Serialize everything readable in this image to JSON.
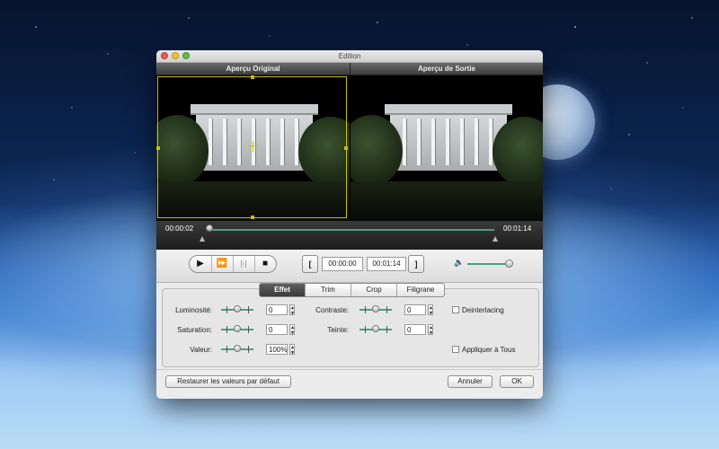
{
  "window": {
    "title": "Edition"
  },
  "preview": {
    "original_label": "Aperçu Original",
    "output_label": "Aperçu de Sortie"
  },
  "timeline": {
    "current_time": "00:00:02",
    "end_time": "00:01:14",
    "position_fraction": 0.03
  },
  "playback": {
    "play_icon": "play-icon",
    "fast_forward_icon": "fast-forward-icon",
    "clip_icon": "clip-icon",
    "stop_icon": "stop-icon",
    "mark_in_label": "[",
    "mark_out_label": "]",
    "start_time": "00:00:00",
    "stop_time": "00:01:14",
    "volume_icon": "speaker-icon",
    "volume_fraction": 0.9
  },
  "tabs": [
    {
      "label": "Effet",
      "active": true
    },
    {
      "label": "Trim",
      "active": false
    },
    {
      "label": "Crop",
      "active": false
    },
    {
      "label": "Filigrane",
      "active": false
    }
  ],
  "effect": {
    "brightness_label": "Luminosité:",
    "brightness_value": "0",
    "saturation_label": "Saturation:",
    "saturation_value": "0",
    "volume_label": "Valeur:",
    "volume_value": "100%",
    "contrast_label": "Contraste:",
    "contrast_value": "0",
    "hue_label": "Teinte:",
    "hue_value": "0",
    "deinterlacing_label": "Deinterlacing",
    "apply_all_label": "Appliquer à Tous"
  },
  "buttons": {
    "restore_label": "Restaurer les valeurs par défaut",
    "cancel_label": "Annuler",
    "ok_label": "OK"
  },
  "colors": {
    "accent": "#4aa08a",
    "crop_frame": "#c9c000"
  }
}
